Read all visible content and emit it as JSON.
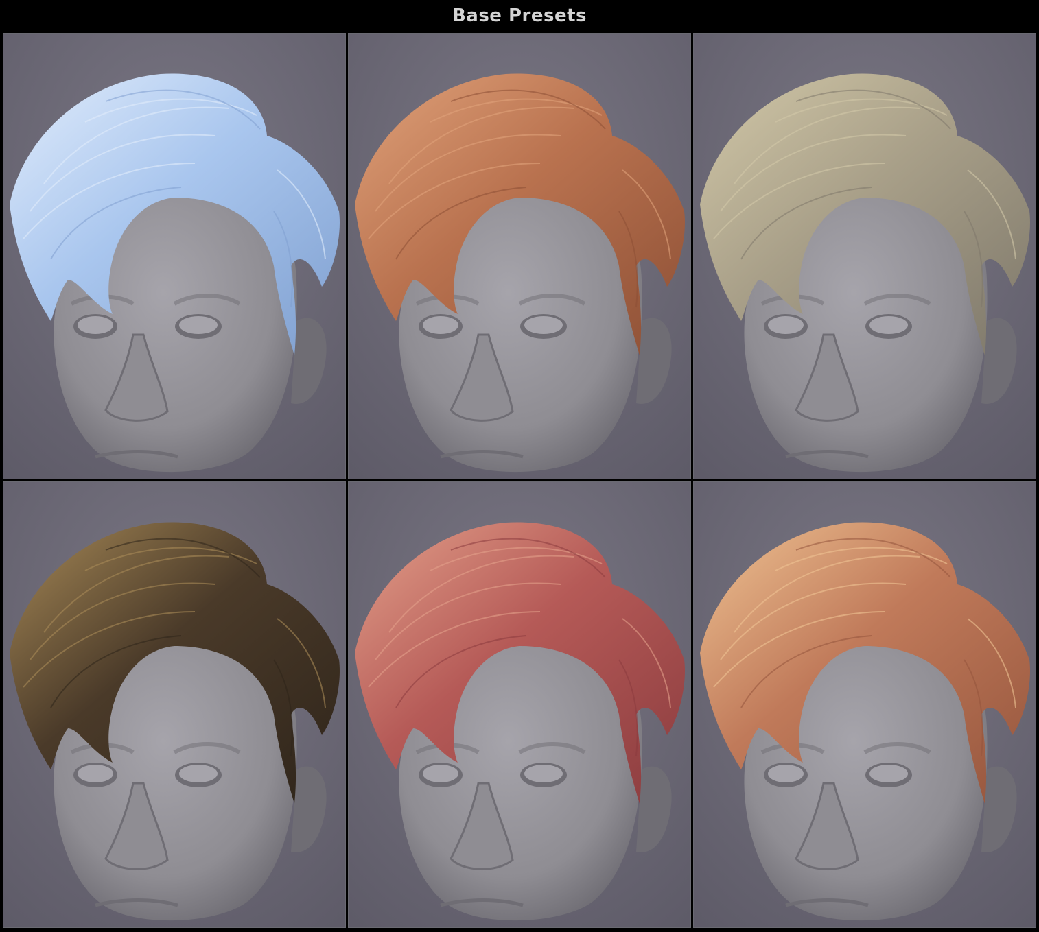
{
  "header": {
    "title": "Base Presets"
  },
  "presets": [
    {
      "color_name": "icy-blue",
      "hair_color": "#a9c6ee",
      "hair_shade": "#7f9fcf",
      "hair_light": "#e1ecfb"
    },
    {
      "color_name": "copper",
      "hair_color": "#b9724f",
      "hair_shade": "#8c4f35",
      "hair_light": "#e0a27a"
    },
    {
      "color_name": "ash-blonde",
      "hair_color": "#a9a089",
      "hair_shade": "#7d776a",
      "hair_light": "#d2c8a8"
    },
    {
      "color_name": "dark-brown",
      "hair_color": "#4a3a29",
      "hair_shade": "#2e241a",
      "hair_light": "#a88a57"
    },
    {
      "color_name": "rose-red",
      "hair_color": "#b55a57",
      "hair_shade": "#8a3b3e",
      "hair_light": "#e3a08a"
    },
    {
      "color_name": "strawberry-blonde",
      "hair_color": "#c07a5a",
      "hair_shade": "#94543c",
      "hair_light": "#efc393"
    }
  ],
  "colors": {
    "background": "#7a7784",
    "background_dark": "#5e5b68",
    "skin": "#8f8d93",
    "skin_shade": "#6f6d74",
    "skin_light": "#a6a4ab"
  }
}
